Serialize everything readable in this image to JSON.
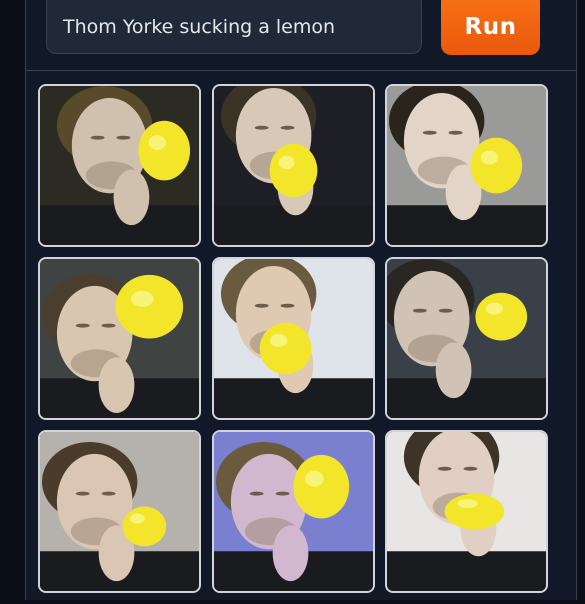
{
  "prompt": {
    "value": "Thom Yorke sucking a lemon"
  },
  "run_button": {
    "label": "Run"
  },
  "gallery": {
    "items": [
      {
        "alt": "generated image 1",
        "bg": "#2b2b24",
        "skin": "#cfc1ad",
        "hair": "#5a4a2c"
      },
      {
        "alt": "generated image 2",
        "bg": "#1d1f24",
        "skin": "#d8c8b8",
        "hair": "#3b3326"
      },
      {
        "alt": "generated image 3",
        "bg": "#9a9a98",
        "skin": "#e3d4c8",
        "hair": "#2b241d"
      },
      {
        "alt": "generated image 4",
        "bg": "#3f4442",
        "skin": "#d8c6b0",
        "hair": "#4a3f2f"
      },
      {
        "alt": "generated image 5",
        "bg": "#dfe4ea",
        "skin": "#dfc9b2",
        "hair": "#6a5a40"
      },
      {
        "alt": "generated image 6",
        "bg": "#3a4048",
        "skin": "#d0c2b4",
        "hair": "#2a2622"
      },
      {
        "alt": "generated image 7",
        "bg": "#b5b2ad",
        "skin": "#dbc6b3",
        "hair": "#4b3b2a"
      },
      {
        "alt": "generated image 8",
        "bg": "#7a7fd0",
        "skin": "#d2b8cf",
        "hair": "#6b5a3c"
      },
      {
        "alt": "generated image 9",
        "bg": "#e7e6e4",
        "skin": "#e1cfc3",
        "hair": "#3d3327"
      }
    ]
  },
  "colors": {
    "accent": "#f97316",
    "lemon": "#f3e62a",
    "background": "#0b0f19",
    "panel": "#111827"
  }
}
